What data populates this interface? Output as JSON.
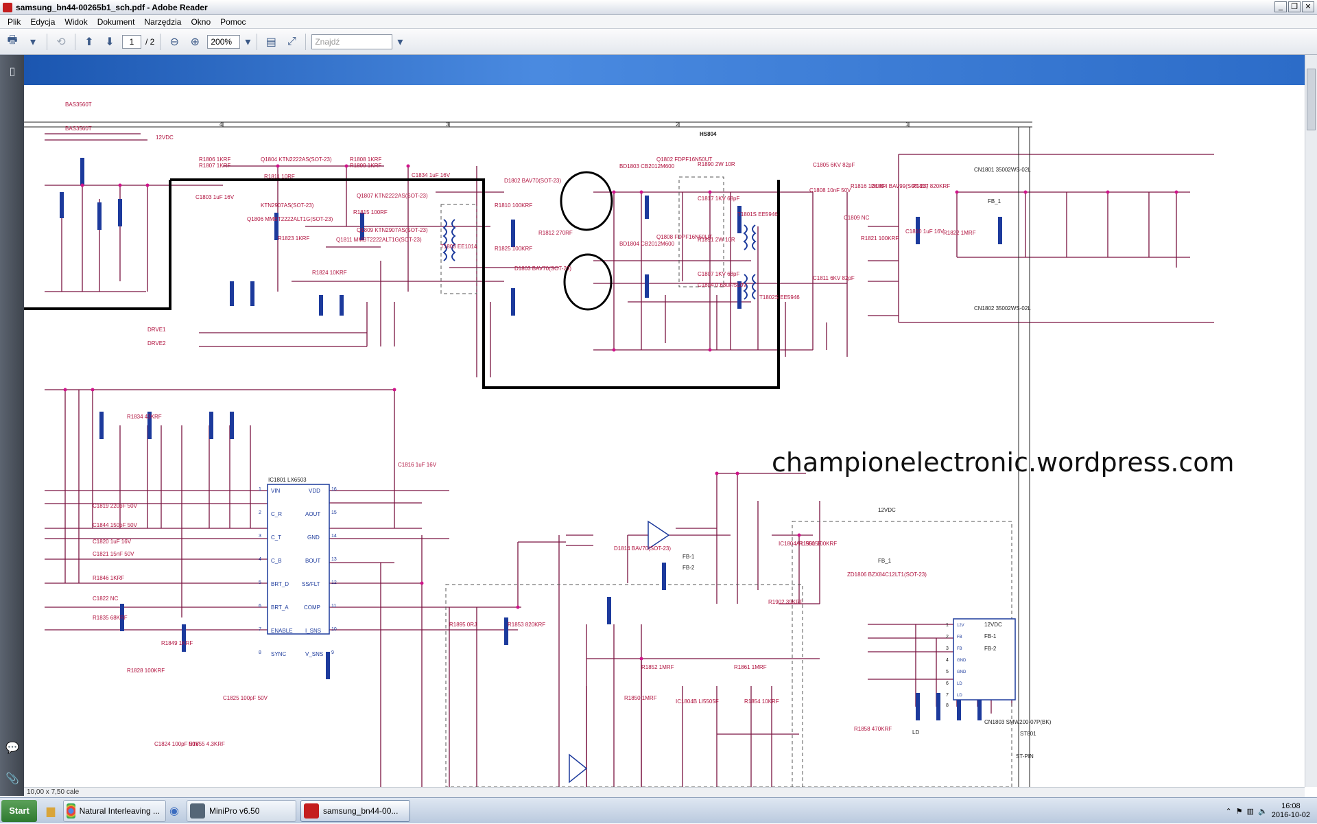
{
  "window": {
    "title": "samsung_bn44-00265b1_sch.pdf - Adobe Reader",
    "min": "_",
    "max": "❐",
    "close": "✕"
  },
  "menu": [
    "Plik",
    "Edycja",
    "Widok",
    "Dokument",
    "Narzędzia",
    "Okno",
    "Pomoc"
  ],
  "toolbar": {
    "page_current": "1",
    "page_total": "/ 2",
    "zoom": "200%",
    "find_placeholder": "Znajdź"
  },
  "status": {
    "page_size": "10,00 x 7,50 cale"
  },
  "watermark": "championelectronic.wordpress.com",
  "schematic": {
    "labels_top": [
      "BAS3560T",
      "BAS3560T",
      "12VDC",
      "R1806 1KRF",
      "R1807 1KRF",
      "Q1804 KTN2222AS(SOT-23)",
      "R1811 10RF",
      "C1803 1uF 16V",
      "KTN2907AS(SOT-23)",
      "Q1806 MMBT2222ALT1G(SOT-23)",
      "R1808 1KRF",
      "R1809 1KRF",
      "C1834 1uF 16V",
      "Q1807 KTN2222AS(SOT-23)",
      "R1815 100RF",
      "Q1809 KTN2907AS(SOT-23)",
      "Q1811 MMBT2222ALT1G(SOT-23)",
      "R1823 1KRF",
      "R1824 10KRF",
      "DRVE1",
      "DRVE2",
      "T1803 EE1014",
      "D1802 BAV70(SOT-23)",
      "R1810 100KRF",
      "R1812 270RF",
      "D1803 BAV70(SOT-23)",
      "R1825 100KRF",
      "BD1803 CB2012M600",
      "BD1804 CB2012M600",
      "Q1802 FDPF16N50UT",
      "Q1808 FDPF16N50UT",
      "R1890 2W 10R",
      "R1891 2W 10R",
      "C1817 1KV 68pF",
      "C1807 1KV 68pF",
      "C1804 0.68uF/550V",
      "HS804",
      "T1801S EE5946",
      "T1802S EE5946",
      "C1805 6KV 82pF",
      "C1811 6KV 82pF",
      "C1808 10nF 50V",
      "R1816 12KRF",
      "D1804 BAV99(SOT-23)",
      "R1817 820KRF",
      "C1809 NC",
      "R1821 100KRF",
      "C1810 1uF 16V",
      "R1822 1MRF",
      "FB_1",
      "CN1801 35002WS-02L",
      "CN1802 35002WS-02L"
    ],
    "labels_bottom": [
      "R1834 43KRF",
      "IC1801 LX6503",
      "VIN",
      "C_R",
      "C_T",
      "C_B",
      "BRT_D",
      "BRT_A",
      "ENABLE",
      "SYNC",
      "VDD",
      "AOUT",
      "GND",
      "BOUT",
      "SS/FLT",
      "COMP",
      "I_SNS",
      "V_SNS",
      "C1816 1uF 16V",
      "C1819 220pF 50V",
      "C1844 150pF 50V",
      "C1820 1uF 16V",
      "C1821 15nF 50V",
      "R1846 1KRF",
      "C1822 NC",
      "R1835 68KRF",
      "R1849 1KRF",
      "R1895 0RJ",
      "R1853 820KRF",
      "D1814 BAV70(SOT-23)",
      "FB-1",
      "FB-2",
      "IC1804A LI5505F",
      "R1901 100KRF",
      "R1902 39KRF",
      "ZD1806 BZX84C12LT1(SOT-23)",
      "FB_1",
      "12VDC",
      "R1852 1MRF",
      "R1861 1MRF",
      "R1850 1MRF",
      "IC1804B LI5505F",
      "R1854 10KRF",
      "R1858 470KRF",
      "LD",
      "12VDC",
      "FB-1",
      "FB-2",
      "CN1803 SMW200-07P(BK)",
      "ST801",
      "ST-PIN",
      "R1828 100KRF",
      "C1824 100pF 50V",
      "R1855 4.3KRF",
      "C1825 100pF 50V"
    ],
    "pin_numbers": [
      "1",
      "2",
      "3",
      "4",
      "5",
      "6",
      "7",
      "8",
      "9",
      "10",
      "11",
      "12",
      "13",
      "14",
      "15",
      "16"
    ],
    "connector_pins": [
      "1",
      "2",
      "3",
      "4",
      "5",
      "6",
      "7",
      "8"
    ],
    "connector_names": [
      "12V",
      "FB",
      "FB",
      "GND",
      "GND",
      "LD",
      "LD"
    ],
    "column_markers": [
      "4",
      "3",
      "2",
      "1"
    ]
  },
  "taskbar": {
    "start": "Start",
    "apps": [
      "Natural Interleaving ...",
      "MiniPro v6.50",
      "samsung_bn44-00..."
    ],
    "time": "16:08",
    "date": "2016-10-02"
  }
}
